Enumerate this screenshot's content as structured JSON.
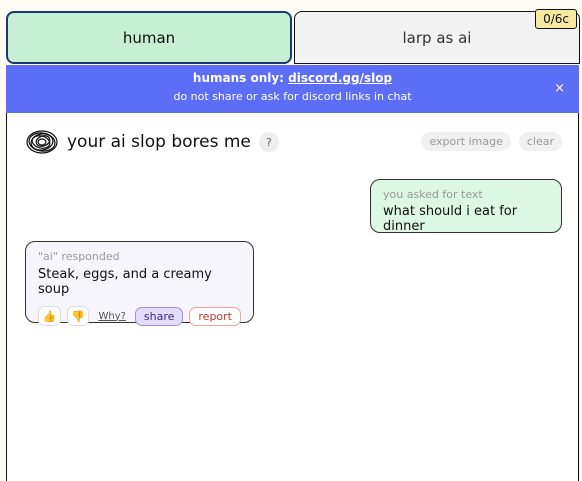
{
  "counter": "0/6c",
  "tabs": {
    "human": "human",
    "larp": "larp as ai"
  },
  "banner": {
    "prefix": "humans only: ",
    "link": "discord.gg/slop",
    "notice": "do not share or ask for discord links in chat",
    "close": "×"
  },
  "header": {
    "title": "your ai slop bores me",
    "help": "?",
    "export_label": "export image",
    "clear_label": "clear"
  },
  "messages": {
    "user": {
      "label": "you asked for text",
      "text": "what should i eat for dinner"
    },
    "ai": {
      "label": "\"ai\" responded",
      "text": "Steak, eggs, and a creamy soup",
      "thumbs_up": "👍",
      "thumbs_down": "👎",
      "why": "Why?",
      "share": "share",
      "report": "report"
    }
  },
  "colors": {
    "human_tab": "#c6efd3",
    "banner": "#5b6ef5",
    "user_bubble": "#dcf7e3",
    "ai_bubble": "#f7f5fc"
  }
}
